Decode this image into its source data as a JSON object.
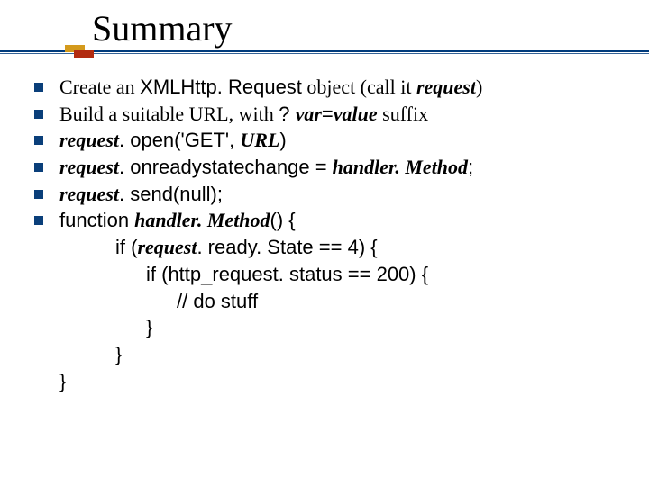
{
  "title": "Summary",
  "bullets": {
    "b0": {
      "pre": "Create an ",
      "code": "XMLHttp. Request",
      "mid": " object (call it ",
      "ital": "request",
      "post": ")"
    },
    "b1": {
      "pre": "Build a suitable URL, with ",
      "code1": "? ",
      "ital1": "var",
      "code2": "=",
      "ital2": "value",
      "post": " suffix"
    },
    "b2": {
      "ital": "request",
      "code1": ". open('GET', ",
      "ital2": "URL",
      "code2": ")"
    },
    "b3": {
      "ital": "request",
      "code": ". onreadystatechange = ",
      "ital2": "handler. Method",
      "post": ";"
    },
    "b4": {
      "ital": "request",
      "code": ". send(null);"
    },
    "b5": {
      "code1": "function ",
      "ital": "handler. Method",
      "code2": "() {"
    }
  },
  "cont": {
    "l1a": "if (",
    "l1ital": "request",
    "l1b": ". ready. State == 4) {",
    "l2": "if (http_request. status == 200) {",
    "l3": "// do stuff",
    "l4": "}",
    "l5": "}",
    "l6": "}"
  }
}
